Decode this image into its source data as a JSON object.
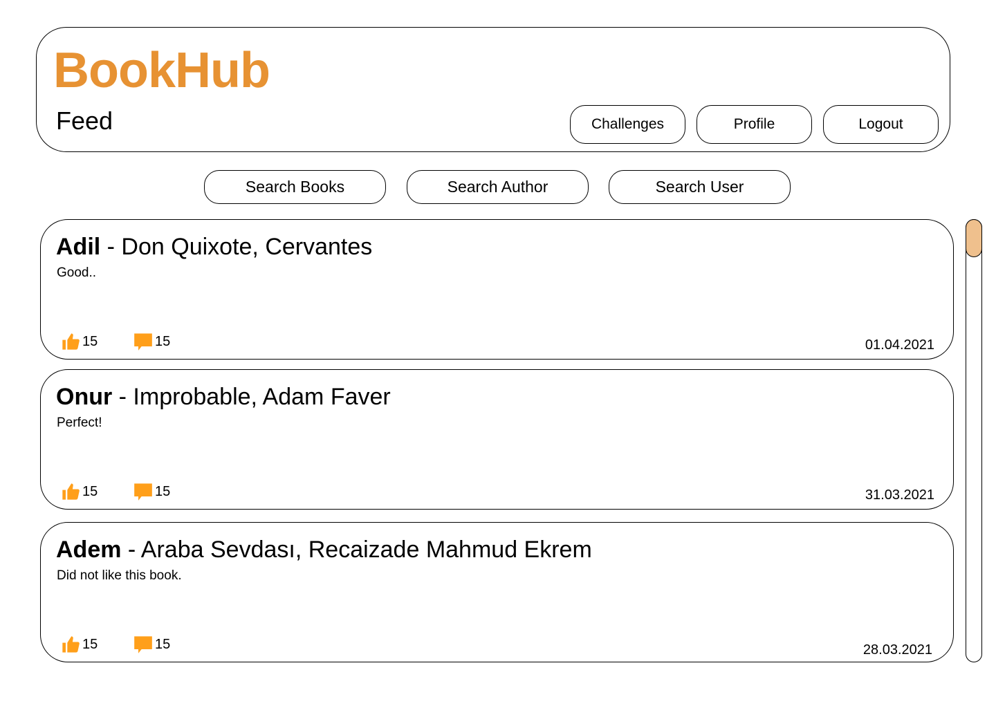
{
  "app": {
    "brand": "BookHub",
    "page_title": "Feed",
    "brand_color": "#e79233",
    "accent_icon_color": "#ff9f1a",
    "scroll_thumb_color": "#efc08d"
  },
  "nav": {
    "challenges_label": "Challenges",
    "profile_label": "Profile",
    "logout_label": "Logout"
  },
  "search": {
    "books_label": "Search Books",
    "author_label": "Search Author",
    "user_label": "Search User"
  },
  "posts": [
    {
      "user": "Adil",
      "book": " - Don Quixote, Cervantes",
      "text": "Good..",
      "likes": "15",
      "comments": "15",
      "date": "01.04.2021"
    },
    {
      "user": "Onur",
      "book": " - Improbable, Adam Faver",
      "text": "Perfect!",
      "likes": "15",
      "comments": "15",
      "date": "31.03.2021"
    },
    {
      "user": "Adem",
      "book": " - Araba Sevdası, Recaizade Mahmud Ekrem",
      "text": "Did not like this book.",
      "likes": "15",
      "comments": "15",
      "date": "28.03.2021"
    }
  ],
  "icons": {
    "like": "thumbs-up-icon",
    "comment": "comment-icon"
  },
  "scroll": {
    "position_fraction": 0
  }
}
